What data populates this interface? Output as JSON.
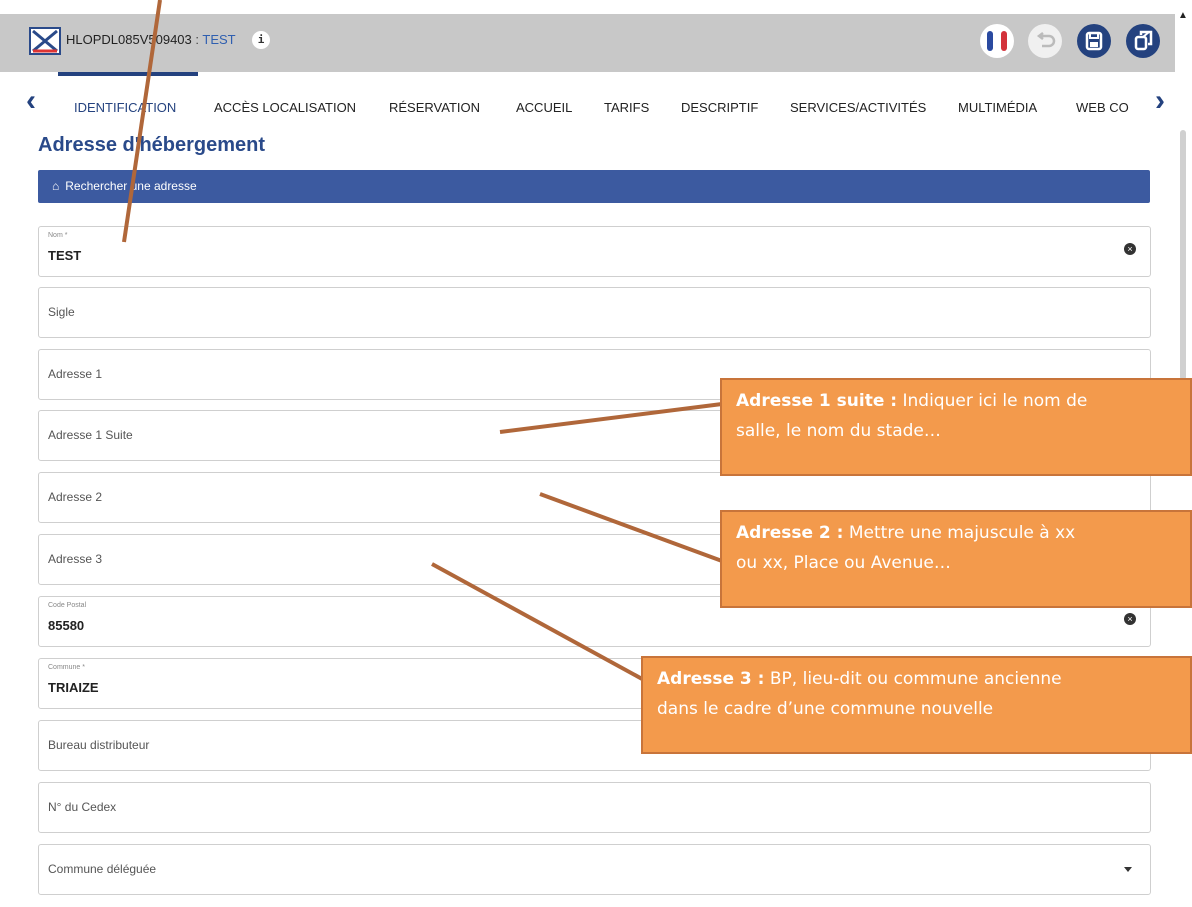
{
  "header": {
    "record_id": "HLOPDL085V509403",
    "separator": " : ",
    "record_name": "TEST",
    "info_icon": "i",
    "buttons": [
      "flag-fr-icon",
      "undo-icon",
      "save-icon",
      "exit-icon"
    ]
  },
  "tabs": {
    "items": [
      {
        "label": "IDENTIFICATION",
        "active": true
      },
      {
        "label": "ACCÈS LOCALISATION"
      },
      {
        "label": "RÉSERVATION"
      },
      {
        "label": "ACCUEIL"
      },
      {
        "label": "TARIFS"
      },
      {
        "label": "DESCRIPTIF"
      },
      {
        "label": "SERVICES/ACTIVITÉS"
      },
      {
        "label": "MULTIMÉDIA"
      },
      {
        "label": "WEB CO"
      }
    ]
  },
  "section": {
    "title": "Adresse d'hébergement",
    "search_label": "Rechercher une adresse"
  },
  "fields": {
    "nom": {
      "label": "Nom *",
      "value": "TEST"
    },
    "sigle": {
      "placeholder": "Sigle"
    },
    "adresse1": {
      "placeholder": "Adresse 1"
    },
    "adresse1_suite": {
      "placeholder": "Adresse 1 Suite"
    },
    "adresse2": {
      "placeholder": "Adresse 2"
    },
    "adresse3": {
      "placeholder": "Adresse 3"
    },
    "code_postal": {
      "label": "Code Postal",
      "value": "85580"
    },
    "commune": {
      "label": "Commune *",
      "value": "TRIAIZE"
    },
    "bureau": {
      "placeholder": "Bureau distributeur"
    },
    "cedex": {
      "placeholder": "N° du Cedex"
    },
    "commune_deleguee": {
      "placeholder": "Commune déléguée"
    }
  },
  "callouts": {
    "c1": {
      "bold": "Adresse 1 suite :",
      "line1": " Indiquer ici le nom de",
      "line2": "salle, le nom du stade…"
    },
    "c2": {
      "bold": "Adresse 2 :",
      "line1": " Mettre une majuscule à xx",
      "line2": "ou xx, Place ou Avenue…"
    },
    "c3": {
      "bold": "Adresse 3 :",
      "line1": " BP, lieu-dit ou commune ancienne",
      "line2": "dans le cadre d’une commune nouvelle"
    }
  },
  "colors": {
    "accent": "#24427f",
    "callout": "#f39a4c",
    "arrow": "#b0673a"
  }
}
